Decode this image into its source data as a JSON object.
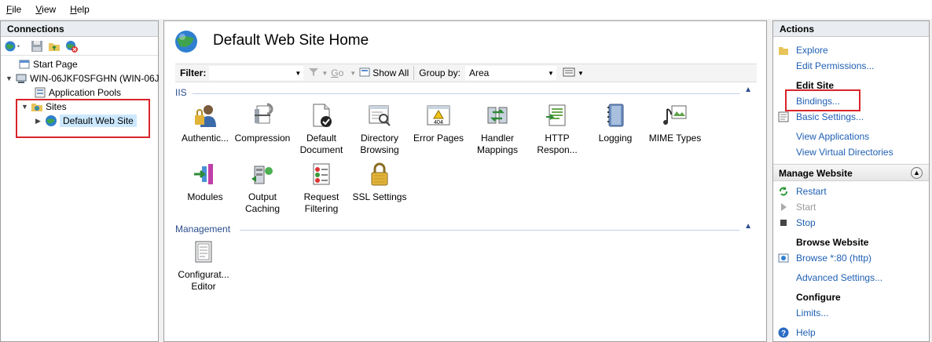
{
  "menu": {
    "file": "File",
    "view": "View",
    "help": "Help"
  },
  "connections": {
    "title": "Connections",
    "tree": {
      "start_page": "Start Page",
      "server": "WIN-06JKF0SFGHN (WIN-06J",
      "app_pools": "Application Pools",
      "sites": "Sites",
      "default_site": "Default Web Site"
    }
  },
  "center": {
    "title": "Default Web Site Home",
    "filter": {
      "label": "Filter:",
      "go": "Go",
      "show_all": "Show All",
      "group_by_label": "Group by:",
      "group_by_value": "Area"
    },
    "groups": {
      "iis": "IIS",
      "management": "Management"
    },
    "iis_features": [
      {
        "label": "Authentic...",
        "icon": "authentication-icon"
      },
      {
        "label": "Compression",
        "icon": "compression-icon"
      },
      {
        "label": "Default Document",
        "icon": "default-document-icon"
      },
      {
        "label": "Directory Browsing",
        "icon": "directory-browsing-icon"
      },
      {
        "label": "Error Pages",
        "icon": "error-pages-icon"
      },
      {
        "label": "Handler Mappings",
        "icon": "handler-mappings-icon"
      },
      {
        "label": "HTTP Respon...",
        "icon": "http-response-icon"
      },
      {
        "label": "Logging",
        "icon": "logging-icon"
      },
      {
        "label": "MIME Types",
        "icon": "mime-types-icon"
      },
      {
        "label": "Modules",
        "icon": "modules-icon"
      },
      {
        "label": "Output Caching",
        "icon": "output-caching-icon"
      },
      {
        "label": "Request Filtering",
        "icon": "request-filtering-icon"
      },
      {
        "label": "SSL Settings",
        "icon": "ssl-settings-icon"
      }
    ],
    "management_features": [
      {
        "label": "Configurat... Editor",
        "icon": "configuration-editor-icon"
      }
    ],
    "error_icon_text": "404"
  },
  "actions": {
    "title": "Actions",
    "explore": "Explore",
    "edit_permissions": "Edit Permissions...",
    "edit_site": "Edit Site",
    "bindings": "Bindings...",
    "basic_settings": "Basic Settings...",
    "view_applications": "View Applications",
    "view_virtual_directories": "View Virtual Directories",
    "manage_website": "Manage Website",
    "restart": "Restart",
    "start": "Start",
    "stop": "Stop",
    "browse_website": "Browse Website",
    "browse_80": "Browse *:80 (http)",
    "advanced_settings": "Advanced Settings...",
    "configure": "Configure",
    "limits": "Limits...",
    "help": "Help"
  },
  "colors": {
    "link": "#1f5fb3",
    "highlight_box": "#d9242b",
    "selection": "#cce8ff"
  }
}
